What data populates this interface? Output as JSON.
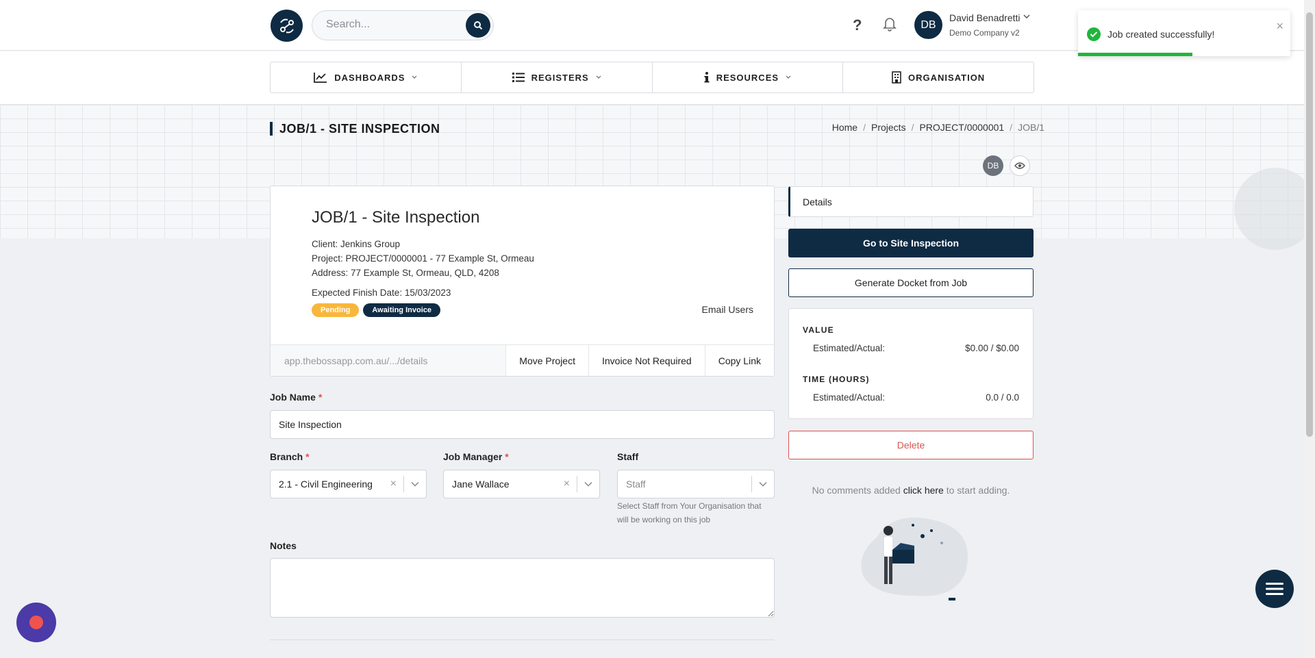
{
  "header": {
    "search_placeholder": "Search...",
    "help_label": "?",
    "user": {
      "initials": "DB",
      "name": "David Benadretti",
      "company": "Demo Company v2"
    }
  },
  "nav": {
    "items": [
      {
        "label": "DASHBOARDS",
        "icon": "chart-line-icon"
      },
      {
        "label": "REGISTERS",
        "icon": "list-icon"
      },
      {
        "label": "RESOURCES",
        "icon": "info-icon"
      },
      {
        "label": "ORGANISATION",
        "icon": "building-icon"
      }
    ]
  },
  "page": {
    "title": "JOB/1 - SITE INSPECTION",
    "breadcrumb": [
      "Home",
      "Projects",
      "PROJECT/0000001",
      "JOB/1"
    ],
    "mini_avatar": "DB"
  },
  "job": {
    "title": "JOB/1 - Site Inspection",
    "client": "Client: Jenkins Group",
    "project": "Project: PROJECT/0000001 - 77 Example St, Ormeau",
    "address": "Address: 77 Example St, Ormeau, QLD, 4208",
    "finish_date": "Expected Finish Date: 15/03/2023",
    "badges": [
      "Pending",
      "Awaiting Invoice"
    ],
    "email_users": "Email Users",
    "link": "app.thebossapp.com.au/.../details",
    "actions": [
      "Move Project",
      "Invoice Not Required",
      "Copy Link"
    ]
  },
  "form": {
    "job_name_label": "Job Name",
    "job_name_value": "Site Inspection",
    "branch_label": "Branch",
    "branch_value": "2.1 - Civil Engineering",
    "manager_label": "Job Manager",
    "manager_value": "Jane Wallace",
    "staff_label": "Staff",
    "staff_placeholder": "Staff",
    "staff_help": "Select Staff from Your Organisation that will be working on this job",
    "notes_label": "Notes",
    "required_mark": "*"
  },
  "sidebar": {
    "details_tab": "Details",
    "go_button": "Go to Site Inspection",
    "docket_button": "Generate Docket from Job",
    "value_heading": "VALUE",
    "value_label": "Estimated/Actual:",
    "value_amount": "$0.00 / $0.00",
    "time_heading": "TIME (HOURS)",
    "time_label": "Estimated/Actual:",
    "time_amount": "0.0 / 0.0",
    "delete_button": "Delete",
    "comments_prefix": "No comments added",
    "comments_link": "click here",
    "comments_suffix": "to start adding."
  },
  "toast": {
    "message": "Job created successfully!",
    "progress": 0.54,
    "color": "#21b53d"
  },
  "colors": {
    "brand": "#0f2b44",
    "pending": "#f8b73c",
    "danger": "#d9534f"
  }
}
